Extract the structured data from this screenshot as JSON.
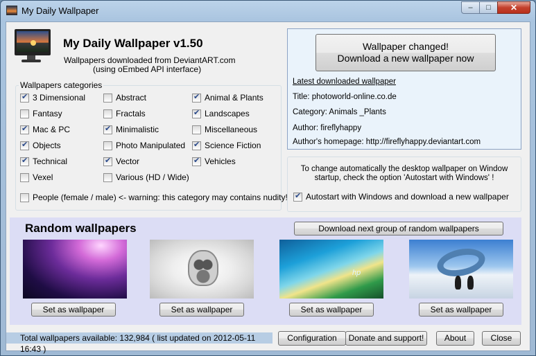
{
  "window": {
    "title": "My Daily Wallpaper",
    "controls": {
      "minimize": "–",
      "maximize": "□",
      "close": "✕"
    }
  },
  "header": {
    "app_title": "My Daily Wallpaper v1.50",
    "subtitle_line1": "Wallpapers downloaded from DeviantART.com",
    "subtitle_line2": "(using oEmbed API interface)",
    "logo_icon": "monitor-sunset-icon"
  },
  "categories": {
    "legend": "Wallpapers categories",
    "items": [
      {
        "label": "3 Dimensional",
        "checked": true
      },
      {
        "label": "Abstract",
        "checked": false
      },
      {
        "label": "Animal & Plants",
        "checked": true
      },
      {
        "label": "Fantasy",
        "checked": false
      },
      {
        "label": "Fractals",
        "checked": false
      },
      {
        "label": "Landscapes",
        "checked": true
      },
      {
        "label": "Mac & PC",
        "checked": true
      },
      {
        "label": "Minimalistic",
        "checked": true
      },
      {
        "label": "Miscellaneous",
        "checked": false
      },
      {
        "label": "Objects",
        "checked": true
      },
      {
        "label": "Photo Manipulated",
        "checked": false
      },
      {
        "label": "Science Fiction",
        "checked": true
      },
      {
        "label": "Technical",
        "checked": true
      },
      {
        "label": "Vector",
        "checked": true
      },
      {
        "label": "Vehicles",
        "checked": true
      },
      {
        "label": "Vexel",
        "checked": false
      },
      {
        "label": "Various (HD / Wide)",
        "checked": false
      }
    ],
    "people": {
      "label": "People (female / male) <- warning: this category may contains nudity!",
      "checked": false
    }
  },
  "info": {
    "changed_button_line1": "Wallpaper changed!",
    "changed_button_line2": "Download a new wallpaper now",
    "latest_label": "Latest downloaded wallpaper",
    "title": "Title: photoworld-online.co.de",
    "category": "Category:  Animals _Plants",
    "author": "Author: fireflyhappy",
    "homepage": "Author's homepage: http://fireflyhappy.deviantart.com"
  },
  "autostart": {
    "description": "To change automatically the desktop wallpaper on Window startup, check the option 'Autostart with Windows' !",
    "checkbox_label": "Autostart with Windows and download a new wallpaper",
    "checked": true
  },
  "random": {
    "title": "Random wallpapers",
    "download_group_label": "Download next group of random wallpapers",
    "set_label": "Set as wallpaper",
    "thumb3_text": "hp"
  },
  "status": {
    "text": "Total wallpapers available: 132,984 ( list updated on 2012-05-11 16:43 )"
  },
  "buttons": {
    "configuration": "Configuration",
    "donate": "Donate and support!",
    "about": "About",
    "close": "Close"
  }
}
